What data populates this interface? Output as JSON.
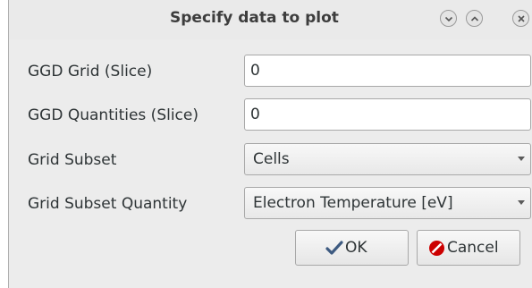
{
  "window": {
    "title": "Specify data to plot"
  },
  "titlebar_buttons": {
    "minimize_icon": "chevron-down-icon",
    "maximize_icon": "chevron-up-icon",
    "close_icon": "close-icon"
  },
  "form": {
    "ggd_grid_label": "GGD Grid (Slice)",
    "ggd_grid_value": "0",
    "ggd_quantities_label": "GGD Quantities (Slice)",
    "ggd_quantities_value": "0",
    "grid_subset_label": "Grid Subset",
    "grid_subset_value": "Cells",
    "grid_subset_quantity_label": "Grid Subset Quantity",
    "grid_subset_quantity_value": "Electron Temperature [eV]"
  },
  "buttons": {
    "ok_label": "OK",
    "cancel_label": "Cancel",
    "ok_icon": "checkmark-icon",
    "cancel_icon": "cancel-icon"
  },
  "colors": {
    "window_bg": "#ececec",
    "checkmark": "#3d5a80",
    "cancel": "#cc0000"
  }
}
